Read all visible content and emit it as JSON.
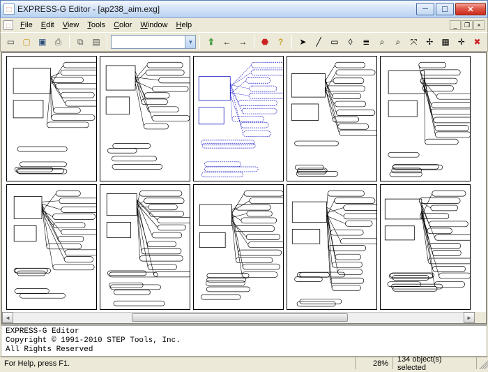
{
  "window": {
    "title": "EXPRESS-G Editor - [ap238_aim.exg]"
  },
  "menubar": {
    "items": [
      {
        "label": "File",
        "hotkey": "F"
      },
      {
        "label": "Edit",
        "hotkey": "E"
      },
      {
        "label": "View",
        "hotkey": "V"
      },
      {
        "label": "Tools",
        "hotkey": "T"
      },
      {
        "label": "Color",
        "hotkey": "C"
      },
      {
        "label": "Window",
        "hotkey": "W"
      },
      {
        "label": "Help",
        "hotkey": "H"
      }
    ]
  },
  "toolbar": {
    "icons_left": [
      {
        "name": "new-icon",
        "glyph": "▭",
        "color": "#555"
      },
      {
        "name": "open-icon",
        "glyph": "📂",
        "color": "#c9a227"
      },
      {
        "name": "save-icon",
        "glyph": "💾",
        "color": "#2a4c7d"
      },
      {
        "name": "print-icon",
        "glyph": "🖶",
        "color": "#555"
      }
    ],
    "icons_copy": [
      {
        "name": "copy-icon",
        "glyph": "⧉",
        "color": "#555"
      },
      {
        "name": "paste-icon",
        "glyph": "📋",
        "color": "#555"
      }
    ],
    "combo_value": "",
    "icons_nav": [
      {
        "name": "nav-up-icon",
        "glyph": "⇑",
        "color": "#1a8a1a"
      },
      {
        "name": "nav-left-icon",
        "glyph": "←",
        "color": "#555"
      },
      {
        "name": "nav-right-icon",
        "glyph": "→",
        "color": "#555"
      }
    ],
    "icons_ops": [
      {
        "name": "stop-icon",
        "glyph": "⬣",
        "color": "#c22"
      },
      {
        "name": "help-icon",
        "glyph": "?",
        "color": "#c9a227"
      }
    ],
    "icons_edit": [
      {
        "name": "pointer-icon",
        "glyph": "▶",
        "color": "#000"
      },
      {
        "name": "line-tool-icon",
        "glyph": "∕",
        "color": "#000"
      },
      {
        "name": "rect-tool-icon",
        "glyph": "▭",
        "color": "#000"
      },
      {
        "name": "rounded-tool-icon",
        "glyph": "◊",
        "color": "#000"
      },
      {
        "name": "align-icon",
        "glyph": "≣",
        "color": "#000"
      },
      {
        "name": "zoom-in-icon",
        "glyph": "🔍",
        "color": "#000"
      },
      {
        "name": "zoom-out-icon",
        "glyph": "🔎",
        "color": "#000"
      },
      {
        "name": "zoom-fit-icon",
        "glyph": "⤧",
        "color": "#000"
      },
      {
        "name": "find-icon",
        "glyph": "🔭",
        "color": "#000"
      },
      {
        "name": "grid-icon",
        "glyph": "▦",
        "color": "#000"
      },
      {
        "name": "snap-icon",
        "glyph": "✛",
        "color": "#000"
      },
      {
        "name": "delete-icon",
        "glyph": "✖",
        "color": "#c22"
      }
    ]
  },
  "msg": {
    "line1": "EXPRESS-G Editor",
    "line2": "Copyright © 1991-2010 STEP Tools, Inc.",
    "line3": "All Rights Reserved"
  },
  "status": {
    "help": "For Help, press F1.",
    "zoom": "28%",
    "selection": "134 object(s) selected"
  },
  "pages": {
    "count": 10,
    "cols": 5,
    "rows": 2
  }
}
